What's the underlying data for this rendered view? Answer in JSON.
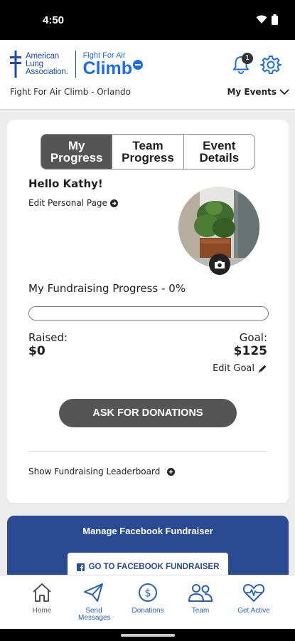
{
  "status": {
    "time": "4:50"
  },
  "header": {
    "lung_logo_line1": "American",
    "lung_logo_line2": "Lung",
    "lung_logo_line3": "Association.",
    "climb_logo_small": "Fight For Air",
    "climb_logo_big": "Climb",
    "notification_count": "1",
    "event_name": "Fight For Air Climb - Orlando",
    "my_events_label": "My Events"
  },
  "tabs": [
    {
      "label": "My\nProgress",
      "active": true
    },
    {
      "label": "Team\nProgress",
      "active": false
    },
    {
      "label": "Event\nDetails",
      "active": false
    }
  ],
  "progress": {
    "greeting": "Hello Kathy!",
    "edit_page_label": "Edit Personal Page",
    "fundraising_title": "My Fundraising Progress - 0%",
    "percent": 0,
    "raised_label": "Raised:",
    "raised_value": "$0",
    "goal_label": "Goal:",
    "goal_value": "$125",
    "edit_goal_label": "Edit Goal",
    "ask_button": "ASK FOR DONATIONS",
    "leaderboard_label": "Show Fundraising Leaderboard"
  },
  "facebook": {
    "title": "Manage Facebook Fundraiser",
    "button_label": "GO TO FACEBOOK FUNDRAISER"
  },
  "nav": {
    "home": "Home",
    "send_messages": "Send Messages",
    "donations": "Donations",
    "team": "Team",
    "get_active": "Get Active"
  },
  "colors": {
    "brand_blue": "#1e6ee0",
    "dark_gray": "#555555",
    "facebook_blue": "#2a4a94"
  }
}
